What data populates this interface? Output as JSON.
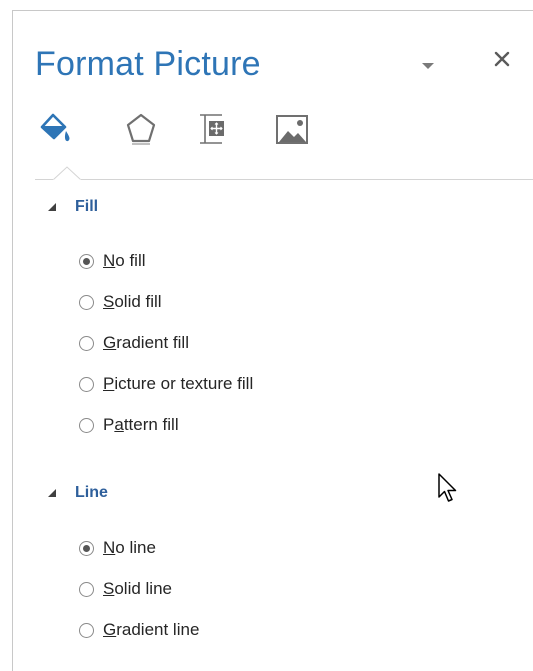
{
  "pane": {
    "title": "Format Picture",
    "tabs": [
      {
        "icon": "fill-line-icon",
        "selected": true
      },
      {
        "icon": "effects-pentagon-icon",
        "selected": false
      },
      {
        "icon": "size-properties-icon",
        "selected": false
      },
      {
        "icon": "picture-icon",
        "selected": false
      }
    ]
  },
  "fill": {
    "label": "Fill",
    "options": [
      {
        "prefix": "",
        "key": "N",
        "suffix": "o fill",
        "checked": true
      },
      {
        "prefix": "",
        "key": "S",
        "suffix": "olid fill",
        "checked": false
      },
      {
        "prefix": "",
        "key": "G",
        "suffix": "radient fill",
        "checked": false
      },
      {
        "prefix": "",
        "key": "P",
        "suffix": "icture or texture fill",
        "checked": false
      },
      {
        "prefix": "P",
        "key": "a",
        "suffix": "ttern fill",
        "checked": false
      }
    ]
  },
  "line": {
    "label": "Line",
    "options": [
      {
        "prefix": "",
        "key": "N",
        "suffix": "o line",
        "checked": true
      },
      {
        "prefix": "",
        "key": "S",
        "suffix": "olid line",
        "checked": false
      },
      {
        "prefix": "",
        "key": "G",
        "suffix": "radient line",
        "checked": false
      }
    ]
  },
  "colors": {
    "accent": "#2e75b6",
    "section_header": "#2e5f9b"
  }
}
